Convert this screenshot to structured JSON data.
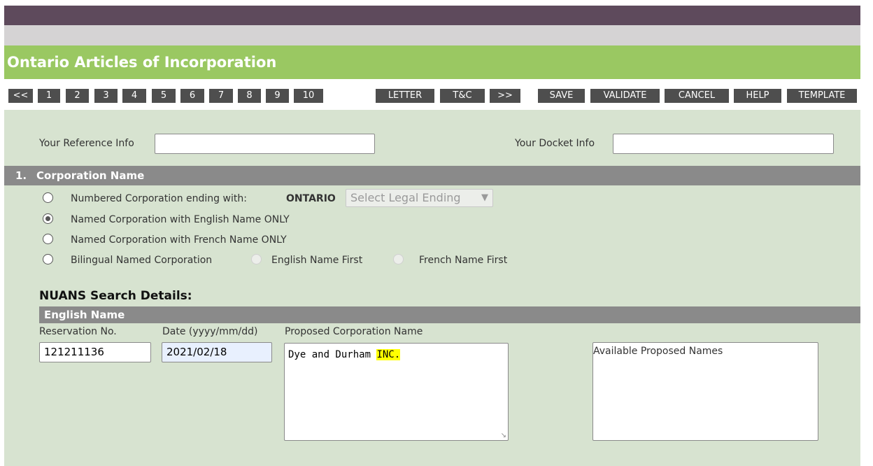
{
  "header": {
    "title": "Ontario Articles of Incorporation"
  },
  "nav": {
    "items": [
      "<<",
      "1",
      "2",
      "3",
      "4",
      "5",
      "6",
      "7",
      "8",
      "9",
      "10",
      "LETTER",
      "T&C",
      ">>"
    ],
    "actions": [
      "SAVE",
      "VALIDATE",
      "CANCEL",
      "HELP",
      "TEMPLATE"
    ]
  },
  "refs": {
    "reference_label": "Your Reference Info",
    "reference_value": "",
    "docket_label": "Your Docket Info",
    "docket_value": ""
  },
  "section1": {
    "number": "1.",
    "title": "Corporation Name",
    "options": [
      {
        "label": "Numbered Corporation ending with:",
        "checked": false
      },
      {
        "label": "Named Corporation with English Name ONLY",
        "checked": true
      },
      {
        "label": "Named Corporation with French Name ONLY",
        "checked": false
      },
      {
        "label": "Bilingual Named Corporation",
        "checked": false
      }
    ],
    "ontario_label": "ONTARIO",
    "legal_ending_placeholder": "Select Legal Ending",
    "bilingual_suboptions": [
      "English Name First",
      "French Name First"
    ]
  },
  "nuans": {
    "title": "NUANS Search Details:",
    "subheader": "English Name",
    "reservation_label": "Reservation No.",
    "reservation_value": "121211136",
    "date_label": "Date (yyyy/mm/dd)",
    "date_value": "2021/02/18",
    "proposed_label": "Proposed Corporation Name",
    "proposed_value": "Dye and Durham",
    "proposed_suffix": "INC.",
    "available_label": "Available Proposed Names"
  },
  "colors": {
    "accent_green": "#9ac862",
    "form_bg": "#d7e3d0",
    "nav_button": "#4e4e4e",
    "section_header": "#8a8a8a",
    "highlight": "#ffff00",
    "top_bar": "#5e4a5c"
  }
}
